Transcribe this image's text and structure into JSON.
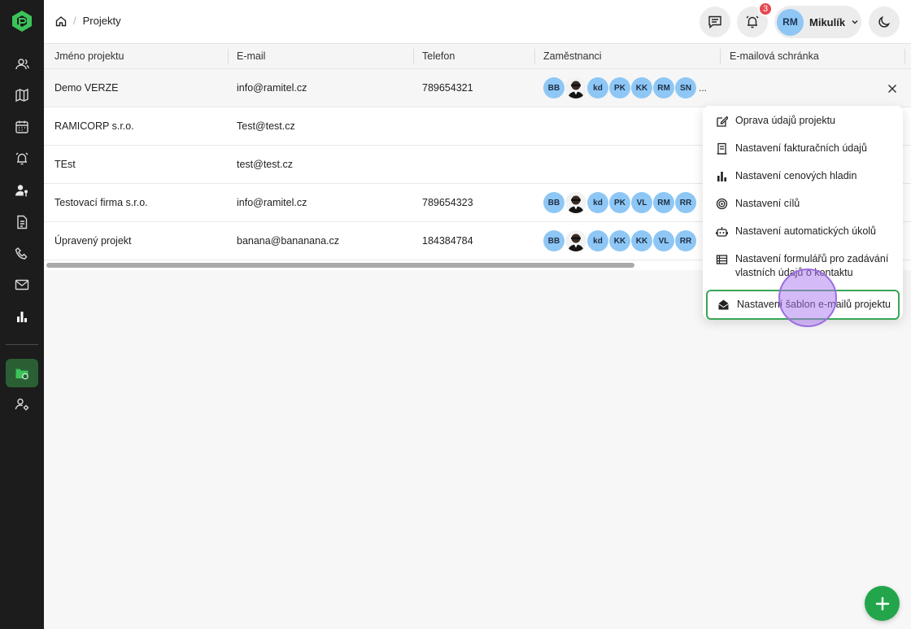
{
  "breadcrumb": {
    "current": "Projekty"
  },
  "header": {
    "notifications_count": "3",
    "user_initials": "RM",
    "user_name": "Mikulík"
  },
  "table": {
    "columns": [
      "Jméno projektu",
      "E-mail",
      "Telefon",
      "Zaměstnanci",
      "E-mailová schránka"
    ],
    "rows": [
      {
        "name": "Demo VERZE",
        "email": "info@ramitel.cz",
        "phone": "789654321",
        "employees": [
          "BB",
          "photo",
          "kd",
          "PK",
          "KK",
          "RM",
          "SN"
        ],
        "more": "..."
      },
      {
        "name": "RAMICORP s.r.o.",
        "email": "Test@test.cz",
        "phone": "",
        "employees": []
      },
      {
        "name": "TEst",
        "email": "test@test.cz",
        "phone": "",
        "employees": []
      },
      {
        "name": "Testovací firma s.r.o.",
        "email": "info@ramitel.cz",
        "phone": "789654323",
        "employees": [
          "BB",
          "photo",
          "kd",
          "PK",
          "VL",
          "RM",
          "RR"
        ]
      },
      {
        "name": "Úpravený projekt",
        "email": "banana@bananana.cz",
        "phone": "184384784",
        "employees": [
          "BB",
          "photo",
          "kd",
          "KK",
          "KK",
          "VL",
          "RR"
        ]
      }
    ]
  },
  "menu": {
    "items": [
      {
        "label": "Oprava údajů projektu",
        "icon": "edit-icon"
      },
      {
        "label": "Nastavení fakturačních údajů",
        "icon": "invoice-icon"
      },
      {
        "label": "Nastavení cenových hladin",
        "icon": "bar-chart-icon"
      },
      {
        "label": "Nastavení cílů",
        "icon": "target-icon"
      },
      {
        "label": "Nastavení automatických úkolů",
        "icon": "robot-icon"
      },
      {
        "label": "Nastavení formulářů pro zadávání vlastních údajů o kontaktu",
        "icon": "form-list-icon"
      },
      {
        "label": "Nastavení šablon e-mailů projektu",
        "icon": "mail-open-icon",
        "selected": true
      }
    ]
  },
  "colors": {
    "sidebar": "#1c1c1c",
    "accent": "#23a64b",
    "avatar": "#8ec7f5",
    "badge": "#e5484d"
  }
}
